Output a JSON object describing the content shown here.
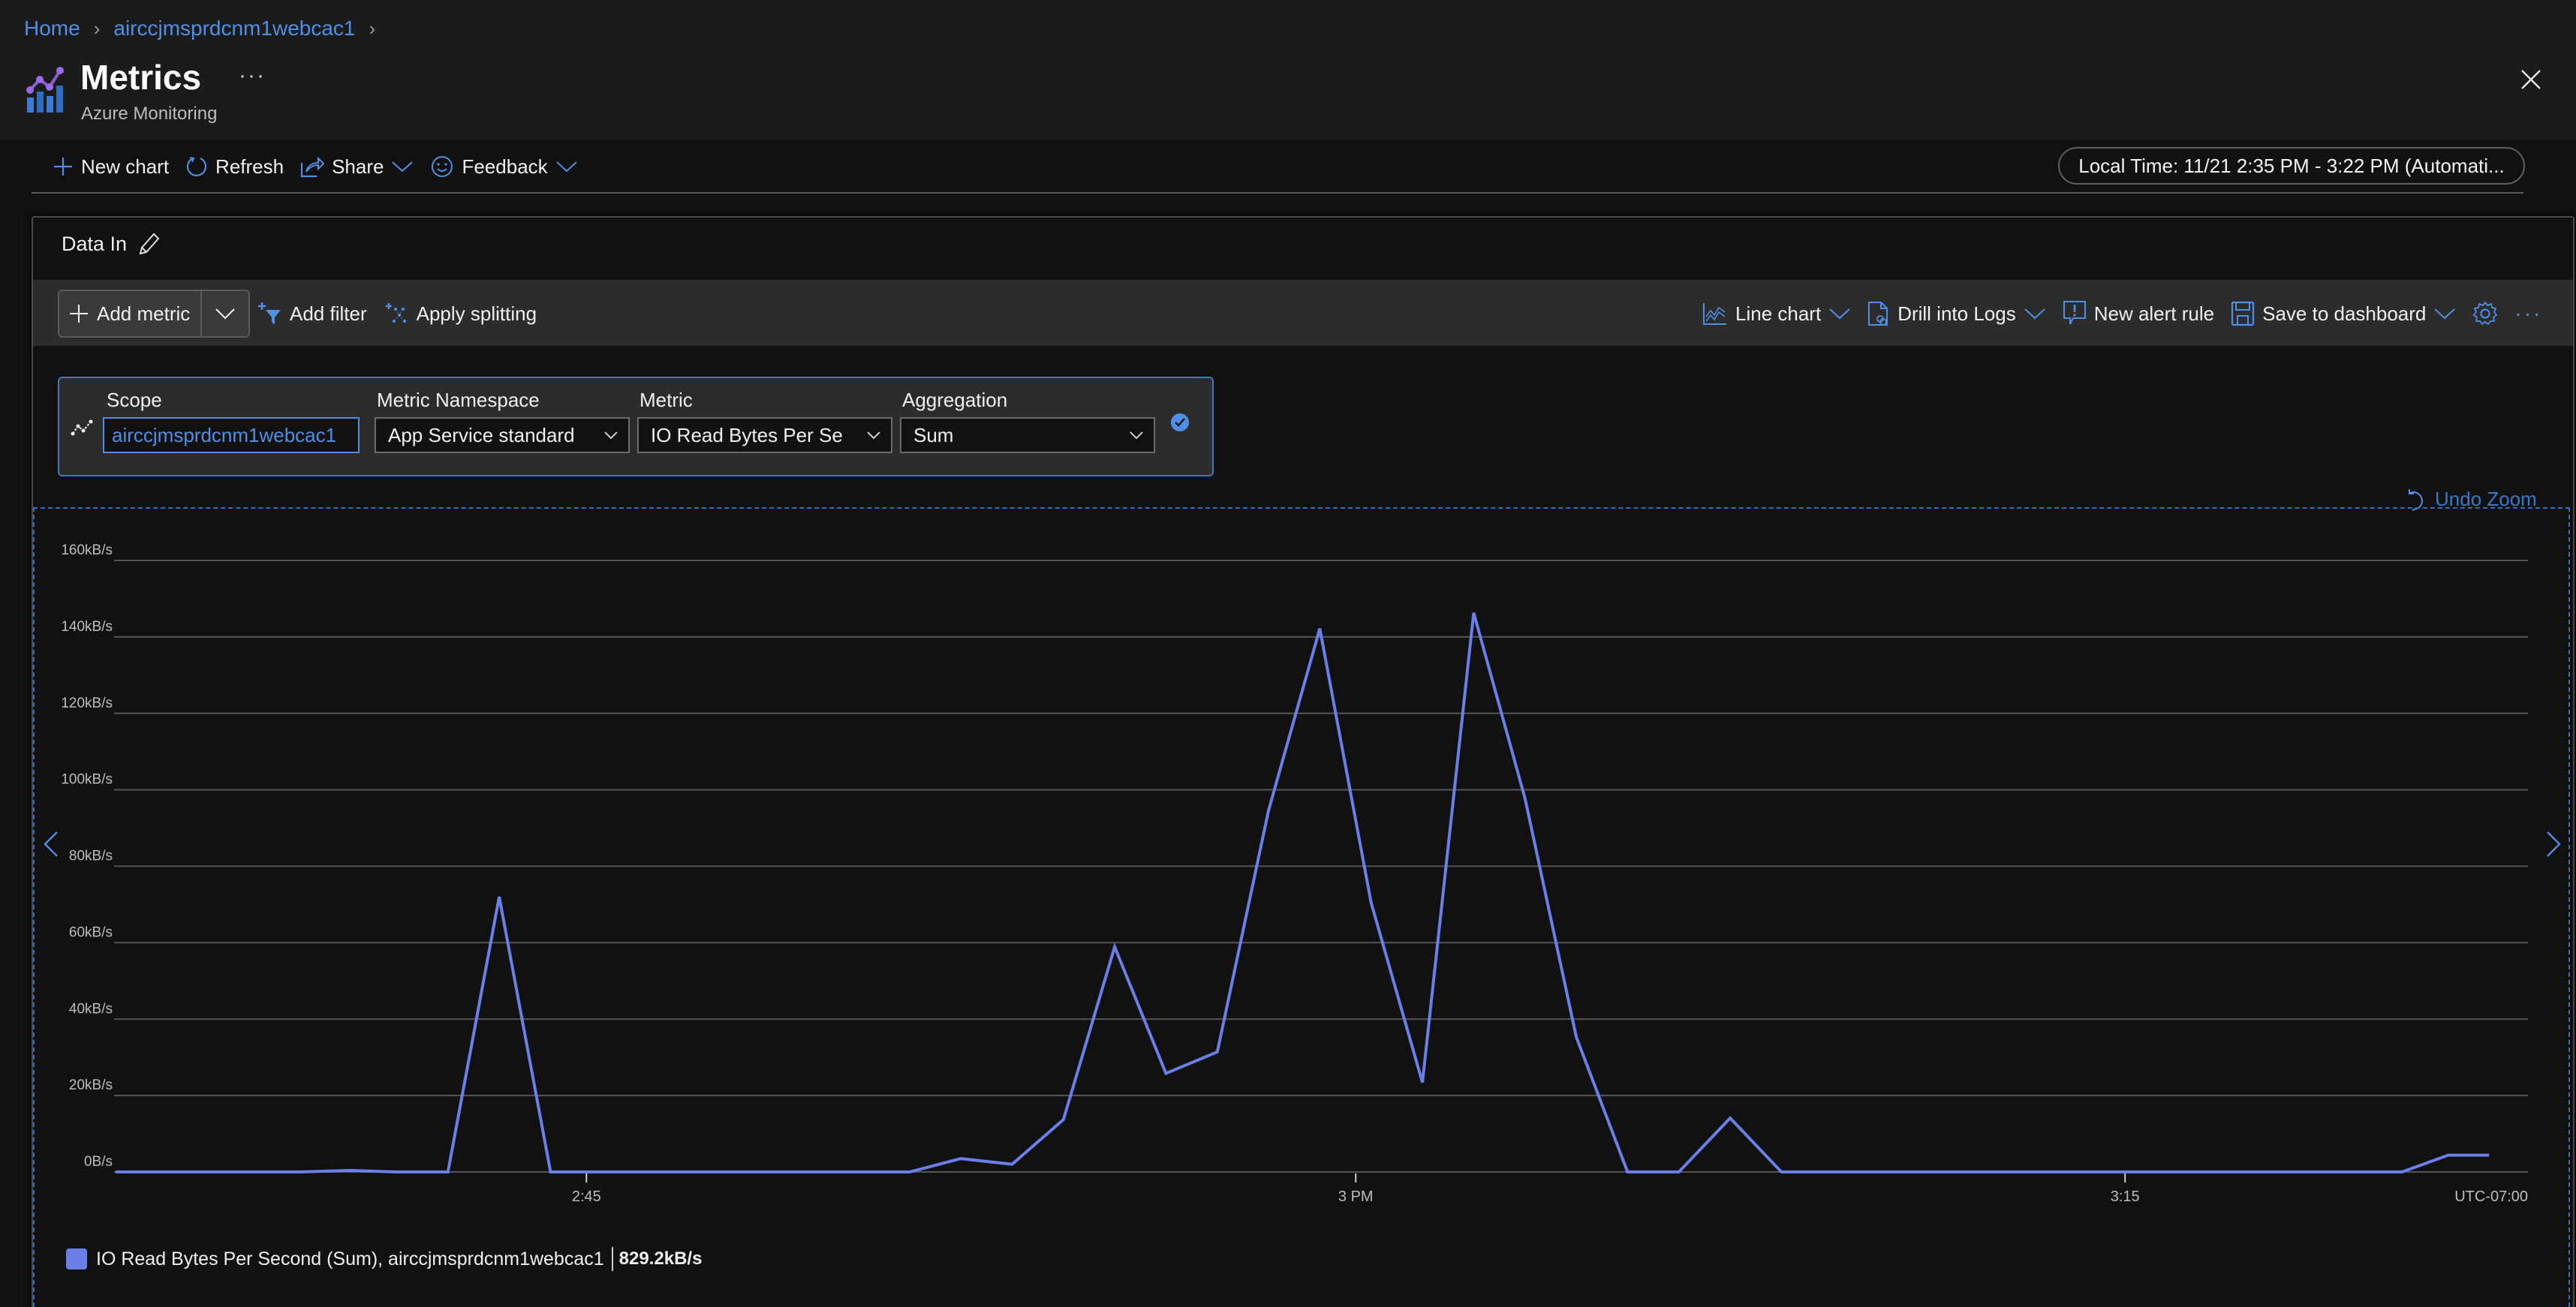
{
  "breadcrumb": [
    {
      "label": "Home"
    },
    {
      "label": "airccjmsprdcnm1webcac1"
    }
  ],
  "header": {
    "title": "Metrics",
    "subtitle": "Azure Monitoring",
    "more_label": "···"
  },
  "command_bar": {
    "new_chart": "New chart",
    "refresh": "Refresh",
    "share": "Share",
    "feedback": "Feedback",
    "time_range": "Local Time: 11/21 2:35 PM - 3:22 PM (Automati..."
  },
  "card": {
    "title": "Data In",
    "toolbar": {
      "add_metric": "Add metric",
      "add_filter": "Add filter",
      "apply_splitting": "Apply splitting",
      "chart_type": "Line chart",
      "drill_logs": "Drill into Logs",
      "new_alert": "New alert rule",
      "save_dashboard": "Save to dashboard"
    },
    "metric_row": {
      "scope_label": "Scope",
      "scope_value": "airccjmsprdcnm1webcac1",
      "namespace_label": "Metric Namespace",
      "namespace_value": "App Service standard",
      "metric_label": "Metric",
      "metric_value": "IO Read Bytes Per Se",
      "aggregation_label": "Aggregation",
      "aggregation_value": "Sum"
    },
    "undo_zoom": "Undo Zoom"
  },
  "legend": {
    "label": "IO Read Bytes Per Second (Sum), airccjmsprdcnm1webcac1",
    "value": "829.2kB/s",
    "color": "#6b7fe8"
  },
  "colors": {
    "accent": "#4f8fe6",
    "series": "#6b7fe8",
    "gridline": "#555555"
  },
  "chart_data": {
    "type": "line",
    "title": "Data In",
    "xlabel": "",
    "ylabel": "",
    "timezone_label": "UTC-07:00",
    "x_unit": "minutes after 2:35 PM",
    "x_range": [
      0,
      47.2
    ],
    "ylim": [
      0,
      160
    ],
    "y_unit": "kB/s",
    "y_ticks": [
      {
        "value": 0,
        "label": "0B/s"
      },
      {
        "value": 20,
        "label": "20kB/s"
      },
      {
        "value": 40,
        "label": "40kB/s"
      },
      {
        "value": 60,
        "label": "60kB/s"
      },
      {
        "value": 80,
        "label": "80kB/s"
      },
      {
        "value": 100,
        "label": "100kB/s"
      },
      {
        "value": 120,
        "label": "120kB/s"
      },
      {
        "value": 140,
        "label": "140kB/s"
      },
      {
        "value": 160,
        "label": "160kB/s"
      }
    ],
    "x_ticks": [
      {
        "value": 10,
        "label": "2:45"
      },
      {
        "value": 25,
        "label": "3 PM"
      },
      {
        "value": 40,
        "label": "3:15"
      }
    ],
    "grid": true,
    "legend_position": "bottom-left",
    "series": [
      {
        "name": "IO Read Bytes Per Second (Sum), airccjmsprdcnm1webcac1",
        "x": [
          0.82,
          1.4,
          2.4,
          3.4,
          4.4,
          5.4,
          6.3,
          7.3,
          8.3,
          9.3,
          10.3,
          11.3,
          12.3,
          13.3,
          14.3,
          15.3,
          16.3,
          17.3,
          18.3,
          19.3,
          20.3,
          21.3,
          22.3,
          23.3,
          24.3,
          25.3,
          26.3,
          27.3,
          28.3,
          29.3,
          30.3,
          31.3,
          32.3,
          33.3,
          34.3,
          35.3,
          36.3,
          37.3,
          38.3,
          39.3,
          40.3,
          41.3,
          42.3,
          43.3,
          44.3,
          45.4,
          46.3,
          47.1
        ],
        "values": [
          0,
          0,
          0,
          0,
          0,
          0.4,
          0,
          0,
          72,
          0,
          0,
          0,
          0,
          0,
          0,
          0,
          0,
          3.5,
          2.0,
          13.7,
          58.9,
          25.8,
          31.4,
          94.6,
          142.2,
          70.5,
          23.4,
          146.3,
          97.8,
          35.3,
          0,
          0,
          14.1,
          0,
          0,
          0,
          0,
          0,
          0,
          0,
          0,
          0,
          0,
          0,
          0,
          0,
          4.4,
          4.4
        ]
      }
    ]
  }
}
